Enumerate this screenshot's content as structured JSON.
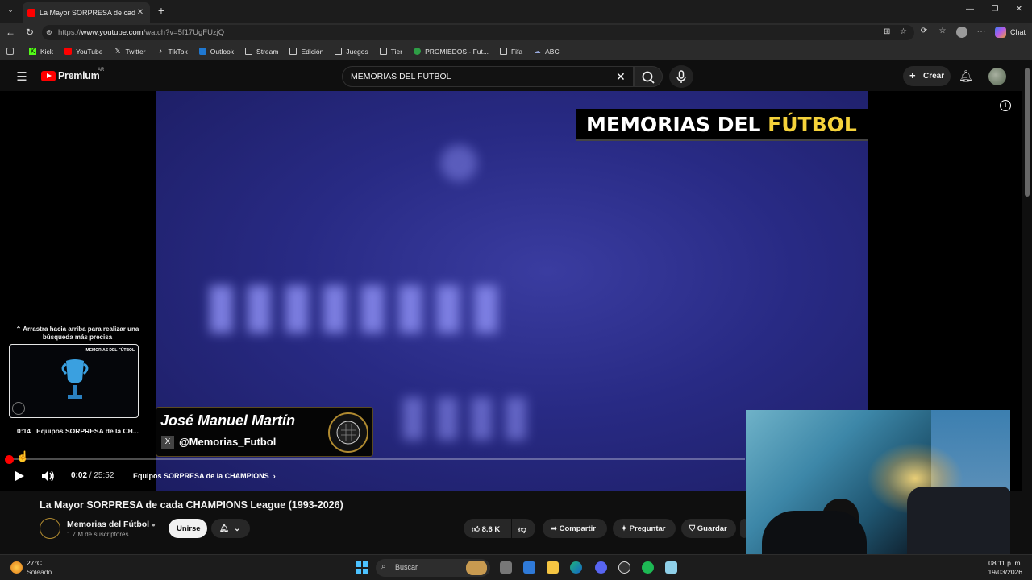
{
  "browser": {
    "tab_title": "La Mayor SORPRESA de cada CHA",
    "url_prefix": "https://",
    "url_domain": "www.youtube.com",
    "url_path": "/watch?v=5f17UgFUzjQ",
    "chat_label": "Chat",
    "bookmarks": [
      "Kick",
      "YouTube",
      "Twitter",
      "TikTok",
      "Outlook",
      "Stream",
      "Edición",
      "Juegos",
      "Tier",
      "PROMIEDOS - Fut...",
      "Fifa",
      "ABC"
    ]
  },
  "youtube": {
    "logo_text": "Premium",
    "region": "AR",
    "search_value": "MEMORIAS DEL FUTBOL",
    "create_label": "Crear"
  },
  "player": {
    "banner_white": "MEMORIAS DEL ",
    "banner_yellow": "FÚTBOL",
    "lower_third_name": "José Manuel Martín",
    "lower_third_handle": "@Memorias_Futbol",
    "pip_hint": "Arrastra hacia arriba para realizar una búsqueda más precisa",
    "pip_time": "0:14",
    "pip_caption": "Equipos SORPRESA de la CH...",
    "pip_thumb_brand": "MEMORIAS DEL FÚTBOL",
    "time_current": "0:02",
    "time_separator": " / ",
    "time_total": "25:52",
    "chapter_title": "Equipos SORPRESA de la CHAMPIONS",
    "progress_fraction": 0.0013
  },
  "video": {
    "title": "La Mayor SORPRESA de cada CHAMPIONS League (1993-2026)",
    "channel": "Memorias del Fútbol",
    "subscribers": "1.7 M de suscriptores",
    "join_label": "Unirse",
    "likes": "8.6 K",
    "share_label": "Compartir",
    "ask_label": "Preguntar",
    "save_label": "Guardar"
  },
  "taskbar": {
    "weather_temp": "27°C",
    "weather_desc": "Soleado",
    "search_placeholder": "Buscar",
    "time": "08:11 p. m.",
    "date": "19/03/2026"
  },
  "colors": {
    "yt_red": "#ff0000",
    "banner_yellow": "#f5d23a",
    "page_bg": "#0f0f0f"
  }
}
